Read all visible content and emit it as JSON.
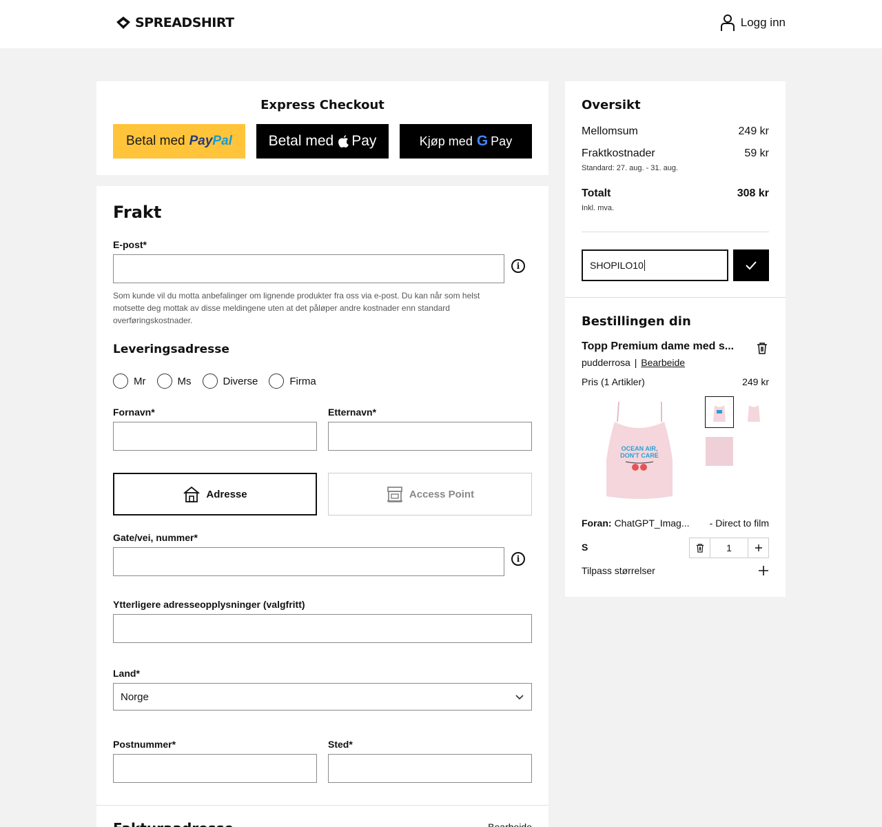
{
  "header": {
    "brand": "SPREADSHIRT",
    "login_label": "Logg inn"
  },
  "express": {
    "title": "Express Checkout",
    "paypal_prefix": "Betal med",
    "paypal_brand_1": "Pay",
    "paypal_brand_2": "Pal",
    "applepay_prefix": "Betal med",
    "applepay_brand": "Pay",
    "gpay_prefix": "Kjøp med",
    "gpay_g": "G",
    "gpay_brand": "Pay"
  },
  "shipping": {
    "title": "Frakt",
    "email_label": "E-post*",
    "email_value": "",
    "email_note": "Som kunde vil du motta anbefalinger om lignende produkter fra oss via e-post. Du kan når som helst motsette deg mottak av disse meldingene uten at det påløper andre kostnader enn standard overføringskostnader.",
    "address_title": "Leveringsadresse",
    "salutations": [
      "Mr",
      "Ms",
      "Diverse",
      "Firma"
    ],
    "firstname_label": "Fornavn*",
    "lastname_label": "Etternavn*",
    "tab_address": "Adresse",
    "tab_access_point": "Access Point",
    "street_label": "Gate/vei, nummer*",
    "extra_label": "Ytterligere adresseopplysninger (valgfritt)",
    "country_label": "Land*",
    "country_value": "Norge",
    "zip_label": "Postnummer*",
    "city_label": "Sted*",
    "next_section_title": "Fakturaadresse",
    "next_section_edit": "Bearbeide"
  },
  "summary": {
    "title": "Oversikt",
    "subtotal_label": "Mellomsum",
    "subtotal_value": "249 kr",
    "shipping_label": "Fraktkostnader",
    "shipping_value": "59 kr",
    "shipping_note": "Standard: 27. aug. - 31. aug.",
    "total_label": "Totalt",
    "total_value": "308 kr",
    "vat_note": "Inkl. mva.",
    "coupon_value": "SHOPILO10"
  },
  "order": {
    "title": "Bestillingen din",
    "product_name": "Topp Premium dame med s...",
    "color": "pudderrosa",
    "edit_link": "Bearbeide",
    "price_label": "Pris (1 Artikler)",
    "price_value": "249 kr",
    "print_text_1": "OCEAN AIR,",
    "print_text_2": "DON'T CARE",
    "front_label": "Foran:",
    "front_value": "ChatGPT_Imag...",
    "front_method": "- Direct to film",
    "size": "S",
    "quantity": "1",
    "adjust_sizes": "Tilpass størrelser"
  },
  "colors": {
    "paypal_yellow": "#ffc43a",
    "black": "#000000",
    "product_pink": "#f4d6dc"
  }
}
